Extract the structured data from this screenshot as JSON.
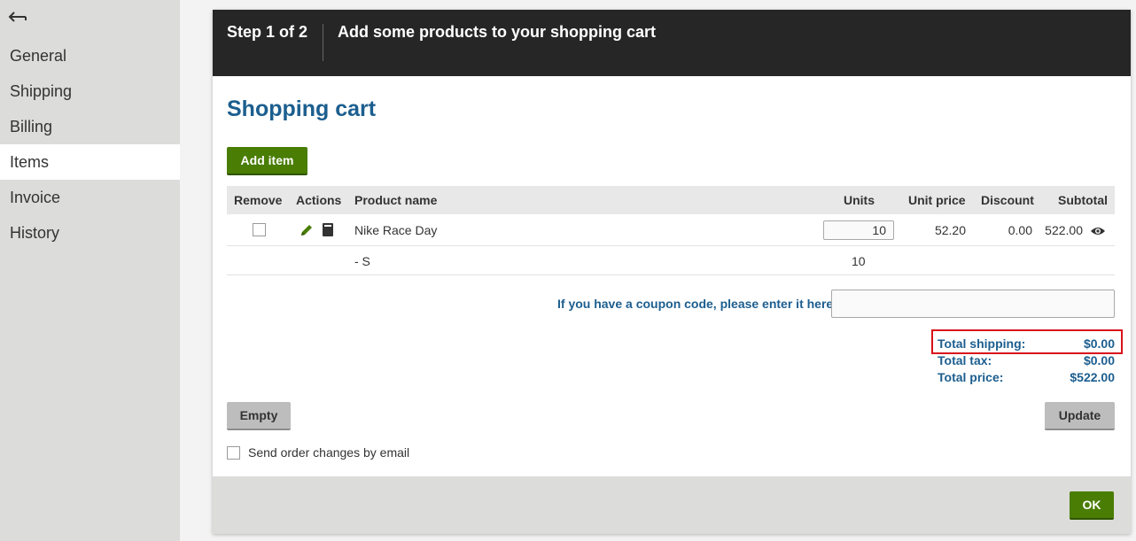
{
  "sidebar": {
    "items": [
      {
        "label": "General"
      },
      {
        "label": "Shipping"
      },
      {
        "label": "Billing"
      },
      {
        "label": "Items"
      },
      {
        "label": "Invoice"
      },
      {
        "label": "History"
      }
    ],
    "active": "Items"
  },
  "dialog": {
    "step": "Step 1 of 2",
    "title": "Add some products to your shopping cart",
    "cart_title": "Shopping cart",
    "add_item_label": "Add item",
    "table": {
      "headers": [
        "Remove",
        "Actions",
        "Product name",
        "Units",
        "Unit price",
        "Discount",
        "Subtotal"
      ],
      "rows": [
        {
          "product": "Nike Race Day",
          "units": "10",
          "unit_price": "52.20",
          "discount": "0.00",
          "subtotal": "522.00"
        },
        {
          "product": "- S",
          "units": "10"
        }
      ]
    },
    "coupon_label": "If you have a coupon code, please enter it here:",
    "coupon_value": "",
    "totals": {
      "shipping_label": "Total shipping:",
      "shipping_value": "$0.00",
      "tax_label": "Total tax:",
      "tax_value": "$0.00",
      "price_label": "Total price:",
      "price_value": "$522.00"
    },
    "empty_label": "Empty",
    "update_label": "Update",
    "send_email_label": "Send order changes by email",
    "ok_label": "OK"
  },
  "colors": {
    "accent_blue": "#1c5e8f",
    "green_button": "#497d04",
    "header_dark": "#262626",
    "highlight_red": "#d8111a"
  }
}
